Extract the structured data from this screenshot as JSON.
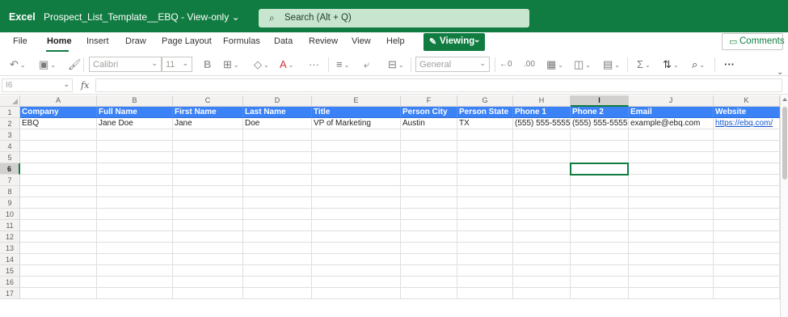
{
  "titlebar": {
    "app_name": "Excel",
    "doc_title": "Prospect_List_Template__EBQ - View-only",
    "doc_chevron": "⌄",
    "search_icon": "search-icon",
    "search_placeholder": "Search (Alt + Q)"
  },
  "menu": {
    "tabs": [
      "File",
      "Home",
      "Insert",
      "Draw",
      "Page Layout",
      "Formulas",
      "Data",
      "Review",
      "View",
      "Help"
    ],
    "active_tab": "Home",
    "viewing_label": "Viewing",
    "comments_label": "Comments"
  },
  "ribbon": {
    "font_name": "Calibri",
    "font_size": "11",
    "number_format": "General",
    "bold_label": "B",
    "sum_label": "Σ",
    "more_label": "···"
  },
  "formula_bar": {
    "name_box": "I6",
    "fx_label": "fx",
    "formula": ""
  },
  "grid": {
    "columns": [
      "A",
      "B",
      "C",
      "D",
      "E",
      "F",
      "G",
      "H",
      "I",
      "J",
      "K"
    ],
    "rows": [
      "1",
      "2",
      "3",
      "4",
      "5",
      "6",
      "7",
      "8",
      "9",
      "10",
      "11",
      "12",
      "13",
      "14",
      "15",
      "16",
      "17"
    ],
    "selected_column": "I",
    "selected_row": "6",
    "header_row": [
      "Company",
      "Full Name",
      "First Name",
      "Last Name",
      "Title",
      "Person City",
      "Person State",
      "Phone 1",
      "Phone 2",
      "Email",
      "Website"
    ],
    "data_row": [
      "EBQ",
      "Jane Doe",
      "Jane",
      "Doe",
      "VP of Marketing",
      "Austin",
      "TX",
      "(555) 555-5555",
      "(555) 555-5555",
      "example@ebq.com",
      "https://ebq.com/"
    ]
  },
  "colors": {
    "excel_green": "#107c41",
    "header_fill": "#3b82f6",
    "link": "#1155cc"
  }
}
